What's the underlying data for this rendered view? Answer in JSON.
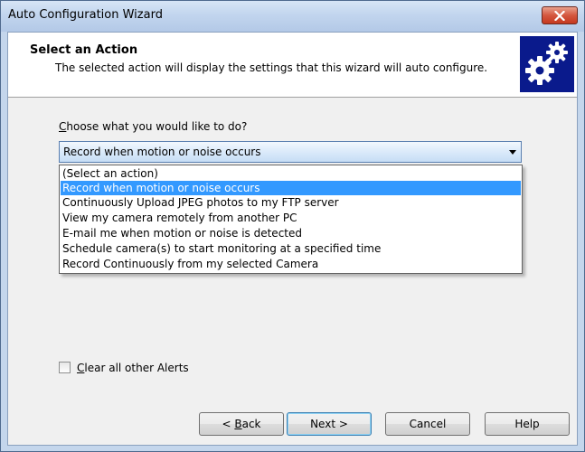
{
  "window": {
    "title": "Auto Configuration Wizard"
  },
  "header": {
    "title": "Select an Action",
    "subtitle": "The selected action will display the settings that this wizard will auto configure.",
    "icon": "gears-icon"
  },
  "action": {
    "label_prefix": "",
    "label_mnemonic": "C",
    "label_rest": "hoose what you would like to do?",
    "selected_value": "Record when motion or noise occurs",
    "options": [
      "(Select an action)",
      "Record when motion or noise occurs",
      "Continuously Upload JPEG photos to my FTP server",
      "View my camera remotely from another PC",
      "E-mail me when motion or noise is detected",
      "Schedule camera(s) to start monitoring at a specified time",
      "Record Continuously from my selected Camera"
    ],
    "highlighted_index": 1
  },
  "clear_alerts": {
    "checked": false,
    "label_mnemonic": "C",
    "label_rest": "lear all other Alerts"
  },
  "buttons": {
    "back_prefix": "< ",
    "back_mnemonic": "B",
    "back_rest": "ack",
    "next": "Next >",
    "cancel": "Cancel",
    "help": "Help"
  },
  "colors": {
    "title_bar": "#c2d5ee",
    "selection": "#3399ff",
    "close_button": "#c5381f",
    "gear_background": "#0a1a8c"
  }
}
